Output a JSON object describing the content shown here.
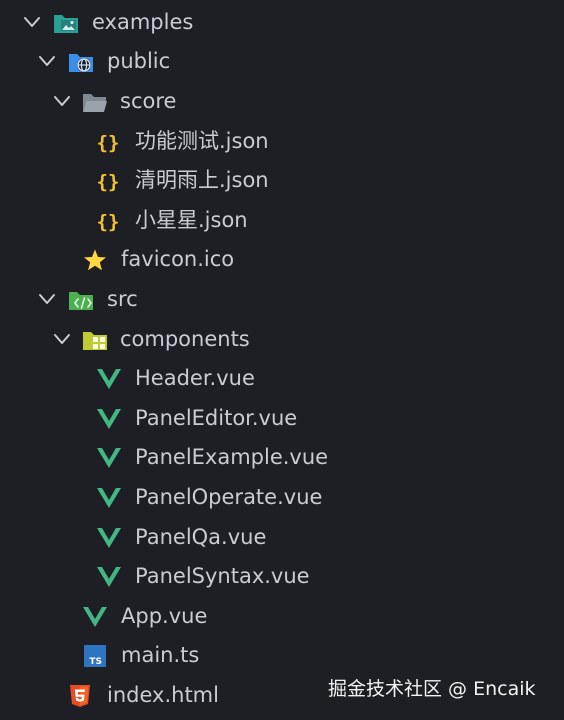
{
  "explorer": {
    "colors": {
      "background": "#1e1f24",
      "text": "#c9ccd2",
      "chevron": "#c9ccd2",
      "json_icon": "#f1c232",
      "vue_icon": "#41b883",
      "html_icon": "#e44d26",
      "ts_icon": "#2f74c0",
      "folder_grey": "#9aa3ad",
      "folder_teal": "#2aa198",
      "folder_blue": "#3b8ee8",
      "folder_green": "#4caf50",
      "folder_yellow": "#c0ca33",
      "star": "#ffd740"
    },
    "items": [
      {
        "label": "examples",
        "icon": "folder-image-icon",
        "expanded": true
      },
      {
        "label": "public",
        "icon": "folder-globe-icon",
        "expanded": true
      },
      {
        "label": "score",
        "icon": "folder-open-icon",
        "expanded": true
      },
      {
        "label": "功能测试.json",
        "icon": "json-icon"
      },
      {
        "label": "清明雨上.json",
        "icon": "json-icon"
      },
      {
        "label": "小星星.json",
        "icon": "json-icon"
      },
      {
        "label": "favicon.ico",
        "icon": "star-icon"
      },
      {
        "label": "src",
        "icon": "folder-code-icon",
        "expanded": true
      },
      {
        "label": "components",
        "icon": "folder-components-icon",
        "expanded": true
      },
      {
        "label": "Header.vue",
        "icon": "vue-icon"
      },
      {
        "label": "PanelEditor.vue",
        "icon": "vue-icon"
      },
      {
        "label": "PanelExample.vue",
        "icon": "vue-icon"
      },
      {
        "label": "PanelOperate.vue",
        "icon": "vue-icon"
      },
      {
        "label": "PanelQa.vue",
        "icon": "vue-icon"
      },
      {
        "label": "PanelSyntax.vue",
        "icon": "vue-icon"
      },
      {
        "label": "App.vue",
        "icon": "vue-icon"
      },
      {
        "label": "main.ts",
        "icon": "typescript-icon"
      },
      {
        "label": "index.html",
        "icon": "html5-icon"
      }
    ]
  },
  "watermark": "掘金技术社区 @ Encaik"
}
